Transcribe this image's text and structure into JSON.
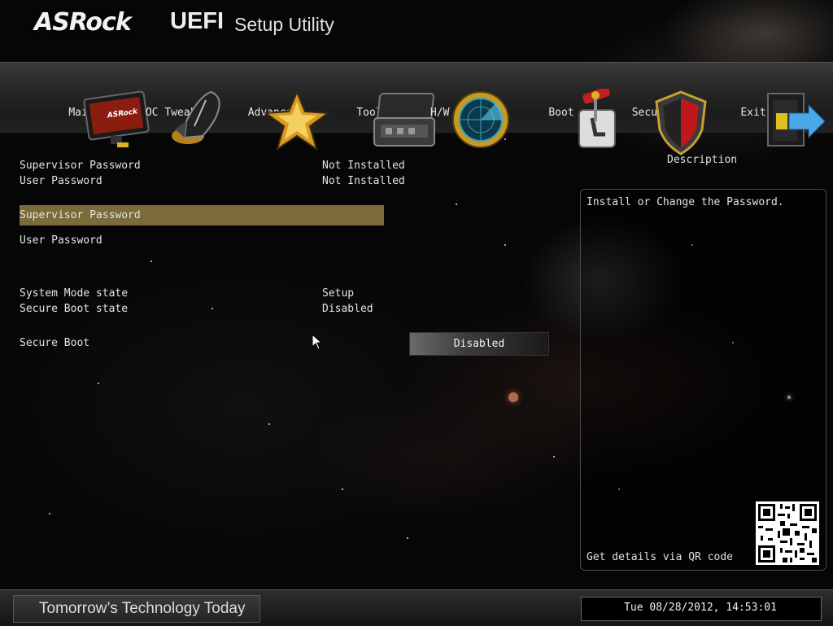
{
  "header": {
    "brand": "ASRock",
    "uefi": "UEFI",
    "subtitle": "Setup Utility"
  },
  "tabs": [
    {
      "label": "Main",
      "icon": "monitor-icon"
    },
    {
      "label": "OC Tweaker",
      "icon": "rocket-icon"
    },
    {
      "label": "Advanced",
      "icon": "star-icon"
    },
    {
      "label": "Tool",
      "icon": "toolbox-icon"
    },
    {
      "label": "H/W Monitor",
      "icon": "radar-icon"
    },
    {
      "label": "Boot",
      "icon": "boot-lever-icon"
    },
    {
      "label": "Security",
      "icon": "shield-icon"
    },
    {
      "label": "Exit",
      "icon": "exit-door-icon"
    }
  ],
  "active_tab": "Security",
  "status": {
    "supervisor_label": "Supervisor Password",
    "supervisor_value": "Not Installed",
    "user_label": "User Password",
    "user_value": "Not Installed"
  },
  "menu": {
    "supervisor_password": "Supervisor Password",
    "user_password": "User Password"
  },
  "secure_state": {
    "system_mode_label": "System Mode state",
    "system_mode_value": "Setup",
    "secure_boot_state_label": "Secure Boot state",
    "secure_boot_state_value": "Disabled"
  },
  "secure_boot": {
    "label": "Secure Boot",
    "value": "Disabled"
  },
  "description": {
    "title": "Description",
    "text": "Install or Change the Password.",
    "qr_label": "Get details via QR code"
  },
  "footer": {
    "motto": "Tomorrow’s Technology Today",
    "datetime": "Tue 08/28/2012, 14:53:01"
  },
  "colors": {
    "selection": "#7b6a3a",
    "text": "#e4e4e4"
  }
}
